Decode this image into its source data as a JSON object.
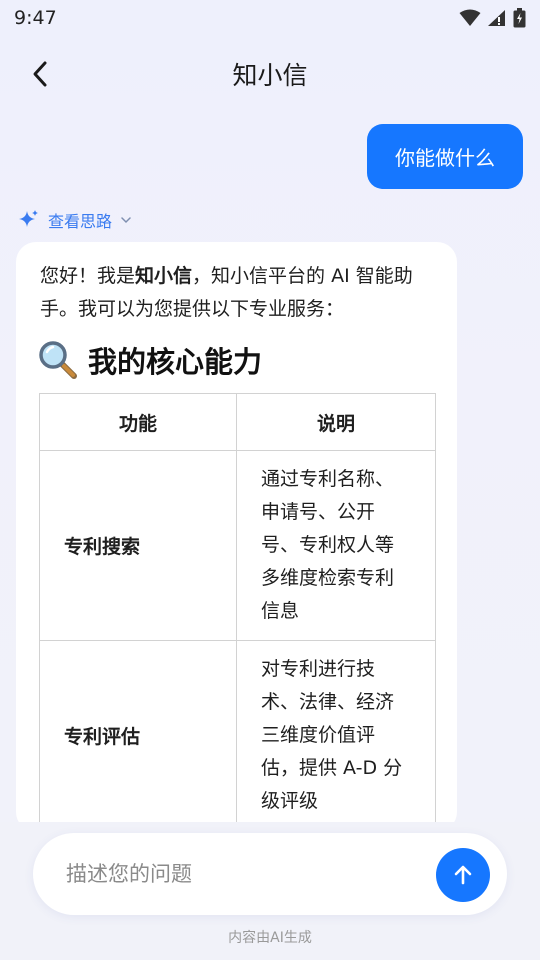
{
  "status_bar": {
    "time": "9:47",
    "icons": [
      "wifi-icon",
      "signal-icon",
      "battery-icon"
    ]
  },
  "header": {
    "back_icon": "chevron-left-icon",
    "title": "知小信"
  },
  "conversation": {
    "user_message": "你能做什么",
    "thinking": {
      "label": "查看思路",
      "icon": "sparkle-icon"
    },
    "answer": {
      "intro_prefix": "您好！我是",
      "intro_bold": "知小信",
      "intro_suffix": "，知小信平台的 AI 智能助手。我可以为您提供以下专业服务：",
      "section_icon": "magnifier-icon",
      "section_title": "我的核心能力",
      "table": {
        "headers": [
          "功能",
          "说明"
        ],
        "rows": [
          {
            "function": "专利搜索",
            "description": "通过专利名称、申请号、公开号、专利权人等多维度检索专利信息"
          },
          {
            "function": "专利评估",
            "description": "对专利进行技术、法律、经济三维度价值评估，提供 A-D 分级评级"
          }
        ]
      }
    }
  },
  "input": {
    "placeholder": "描述您的问题",
    "send_icon": "arrow-up-icon"
  },
  "footer": {
    "note": "内容由AI生成"
  },
  "colors": {
    "accent": "#1677ff",
    "link": "#3a7bf0",
    "background": "#eff0fb"
  }
}
